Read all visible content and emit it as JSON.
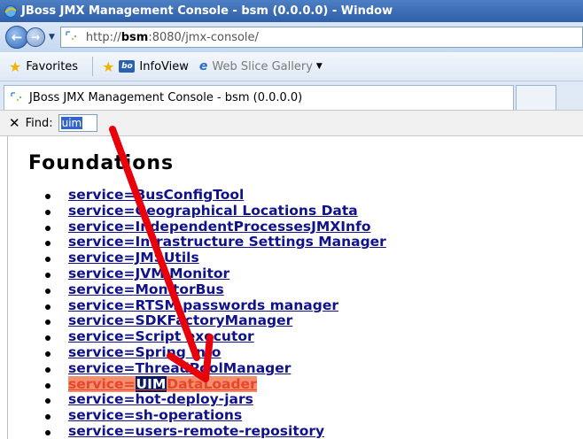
{
  "window": {
    "title": "JBoss JMX Management Console - bsm (0.0.0.0) - Window"
  },
  "address_bar": {
    "url_prefix": "http://",
    "url_host": "bsm",
    "url_rest": ":8080/jmx-console/"
  },
  "favorites_bar": {
    "favorites_label": "Favorites",
    "items": [
      {
        "label": "InfoView",
        "icon": "infoview-icon"
      },
      {
        "label": "Web Slice Gallery",
        "icon": "ie-icon"
      }
    ]
  },
  "tabs": [
    {
      "label": "JBoss JMX Management Console - bsm (0.0.0.0)"
    }
  ],
  "find_bar": {
    "close": "✕",
    "label": "Find:",
    "value": "uim"
  },
  "page": {
    "heading": "Foundations",
    "services": [
      "service=BusConfigTool",
      "service=Geographical Locations Data",
      "service=IndependentProcessesJMXInfo",
      "service=Infrastructure Settings Manager",
      "service=JMSUtils",
      "service=JVM Monitor",
      "service=MonitorBus",
      "service=RTSM passwords manager",
      "service=SDKFactoryManager",
      "service=Script executor",
      "service=Spring Info",
      "service=ThreadPoolManager",
      "service=UIMDataLoader",
      "service=hot-deploy-jars",
      "service=sh-operations",
      "service=users-remote-repository"
    ],
    "highlighted_service": {
      "prefix": "service=",
      "match": "UIM",
      "suffix": "DataLoader"
    }
  },
  "colors": {
    "link": "#10128c",
    "highlight_text": "#e8452a",
    "highlight_bg": "#f38e6e",
    "match_bg": "#0b1a5e",
    "arrow": "#e8000b"
  }
}
